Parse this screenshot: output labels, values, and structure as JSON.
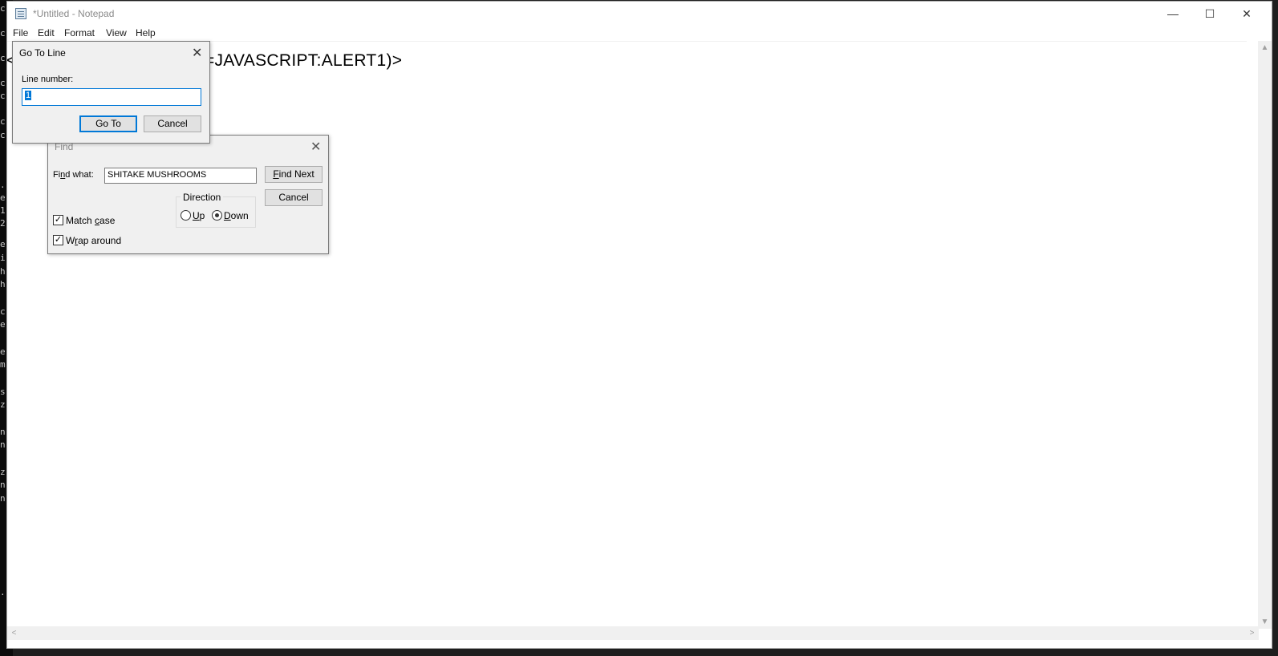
{
  "left_strip": [
    "c",
    "c",
    "c",
    "c",
    "c",
    "c",
    "c",
    ".",
    "e",
    "1",
    "2",
    "e",
    "i",
    "h",
    "h",
    "c",
    "e",
    "e",
    "m",
    "s",
    "z",
    "n",
    "n",
    "z",
    "n",
    "n",
    "."
  ],
  "window": {
    "title": "*Untitled - Notepad",
    "controls": {
      "minimize": "—",
      "maximize": "☐",
      "close": "✕"
    }
  },
  "menu": [
    "File",
    "Edit",
    "Format",
    "View",
    "Help"
  ],
  "editor": {
    "text": "<IMG SRC=X ONERROR=JAVASCRIPT:ALERT1)>"
  },
  "scroll": {
    "up": "▲",
    "down": "▼",
    "left": "<",
    "right": ">"
  },
  "goto_dialog": {
    "title": "Go To Line",
    "close": "✕",
    "label": "Line number:",
    "value": "1",
    "goto_button": "Go To",
    "cancel_button": "Cancel"
  },
  "find_dialog": {
    "title": "Find",
    "close": "✕",
    "find_what_prefix": "Fi",
    "find_what_mn": "n",
    "find_what_suffix": "d what:",
    "search_value": "SHITAKE MUSHROOMS",
    "find_next_mn": "F",
    "find_next_rest": "ind Next",
    "cancel_button": "Cancel",
    "direction_label": "Direction",
    "up_mn": "U",
    "up_rest": "p",
    "down_mn": "D",
    "down_rest": "own",
    "direction_selected": "Down",
    "match_case_prefix": "Match ",
    "match_case_mn": "c",
    "match_case_suffix": "ase",
    "match_case_checked": true,
    "wrap_prefix": "W",
    "wrap_mn": "r",
    "wrap_suffix": "ap around",
    "wrap_checked": true,
    "check_mark": "✓"
  }
}
